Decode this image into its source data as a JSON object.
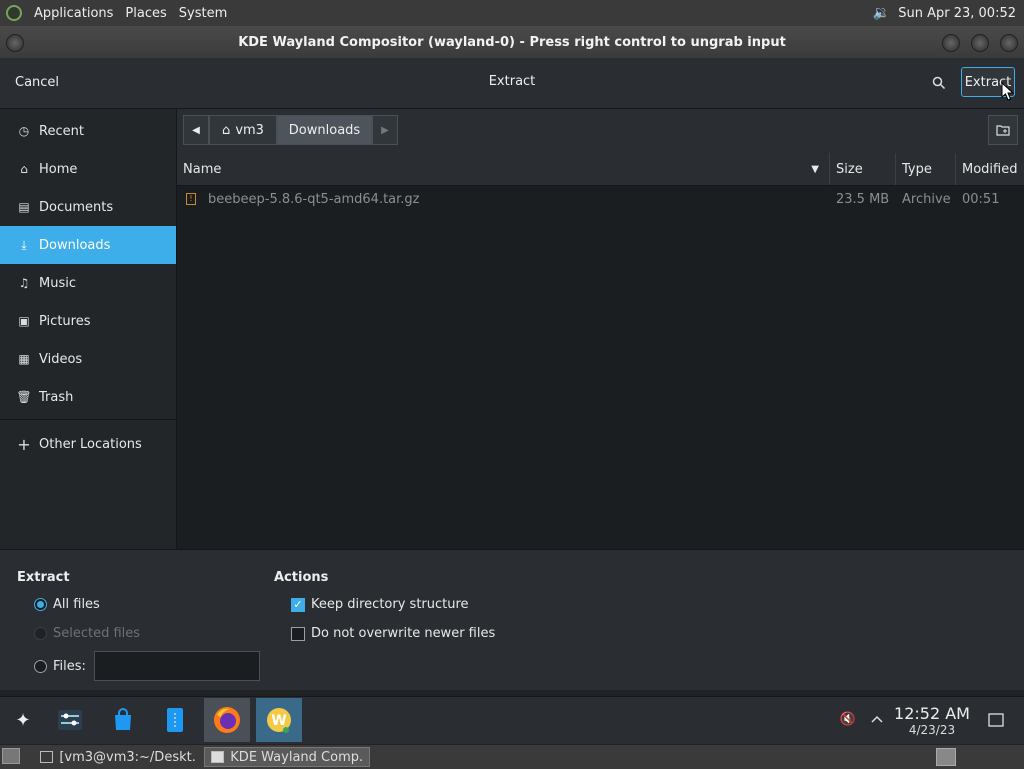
{
  "top_panel": {
    "menus": [
      "Applications",
      "Places",
      "System"
    ],
    "datetime": "Sun Apr 23, 00:52"
  },
  "window": {
    "title": "KDE Wayland Compositor (wayland-0) - Press right control to ungrab input"
  },
  "dialog": {
    "cancel_label": "Cancel",
    "title": "Extract",
    "extract_label": "Extract"
  },
  "sidebar": {
    "items": [
      {
        "label": "Recent",
        "icon": "clock-icon"
      },
      {
        "label": "Home",
        "icon": "home-icon"
      },
      {
        "label": "Documents",
        "icon": "document-icon"
      },
      {
        "label": "Downloads",
        "icon": "download-icon",
        "active": true
      },
      {
        "label": "Music",
        "icon": "music-icon"
      },
      {
        "label": "Pictures",
        "icon": "picture-icon"
      },
      {
        "label": "Videos",
        "icon": "video-icon"
      },
      {
        "label": "Trash",
        "icon": "trash-icon"
      }
    ],
    "other_locations": "Other Locations"
  },
  "pathbar": {
    "crumbs": [
      "vm3",
      "Downloads"
    ]
  },
  "file_list": {
    "columns": [
      "Name",
      "Size",
      "Type",
      "Modified"
    ],
    "rows": [
      {
        "name": "beebeep-5.8.6-qt5-amd64.tar.gz",
        "size": "23.5 MB",
        "type": "Archive",
        "modified": "00:51"
      }
    ]
  },
  "options": {
    "extract_heading": "Extract",
    "all_files": "All files",
    "selected_files": "Selected files",
    "files": "Files:",
    "files_value": "",
    "actions_heading": "Actions",
    "keep_structure": "Keep directory structure",
    "no_overwrite": "Do not overwrite newer files",
    "keep_structure_checked": true,
    "no_overwrite_checked": false
  },
  "plasma_panel": {
    "time": "12:52 AM",
    "date": "4/23/23"
  },
  "taskbar": {
    "tasks": [
      "[vm3@vm3:~/Deskt...",
      "KDE Wayland Comp..."
    ]
  },
  "colors": {
    "accent": "#3daee9"
  }
}
